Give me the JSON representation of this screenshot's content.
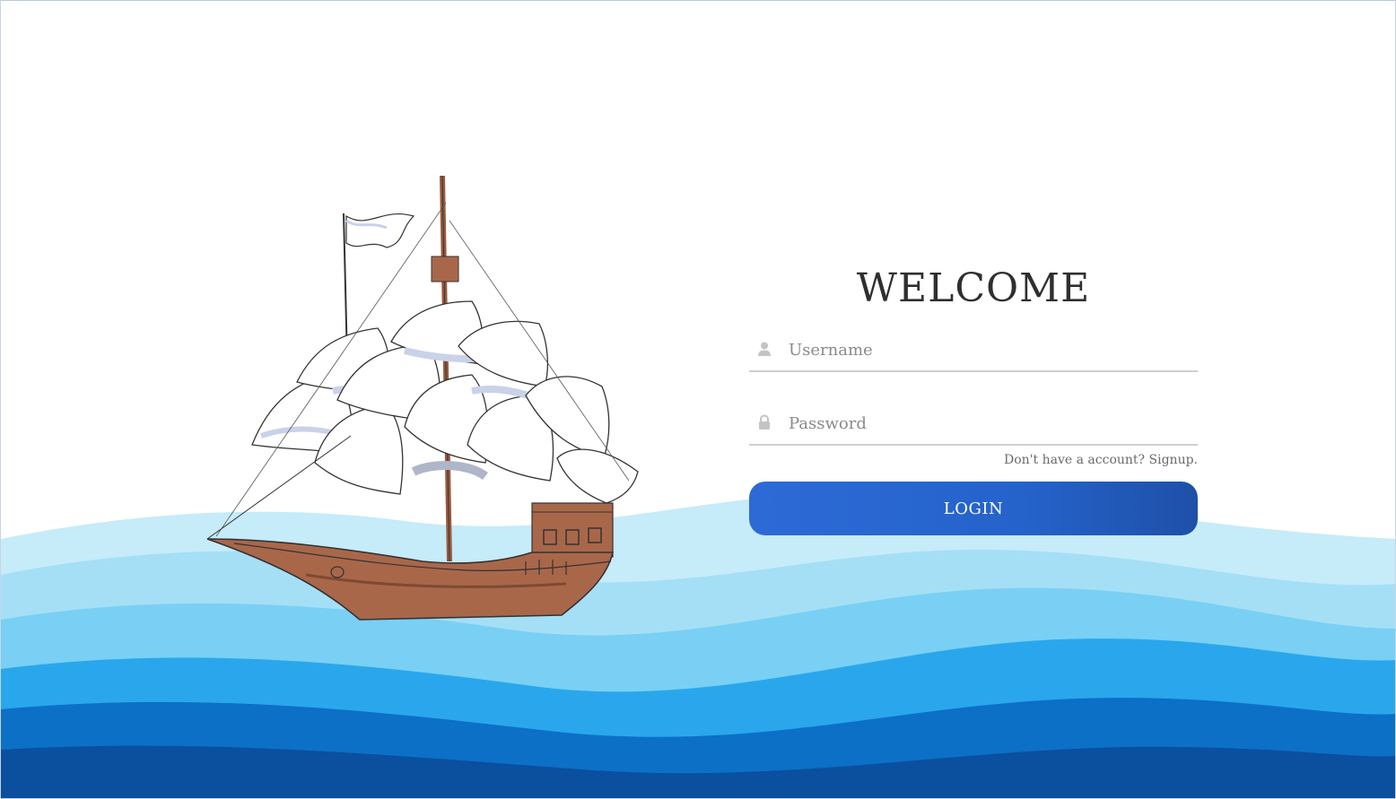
{
  "login": {
    "title": "WELCOME",
    "username_placeholder": "Username",
    "password_placeholder": "Password",
    "signup_prompt": "Don't have a account?",
    "signup_link": "Signup.",
    "login_button": "LOGIN"
  },
  "icons": {
    "username": "user-icon",
    "password": "lock-icon"
  },
  "colors": {
    "button_start": "#2d6ad6",
    "button_end": "#1e50a8",
    "wave_light": "#bfe8f8",
    "wave_mid": "#7dd3f5",
    "wave_bright": "#29a8ec",
    "wave_deep": "#0b6fc4",
    "wave_darkest": "#0a4fa0",
    "hull": "#a9674a"
  }
}
